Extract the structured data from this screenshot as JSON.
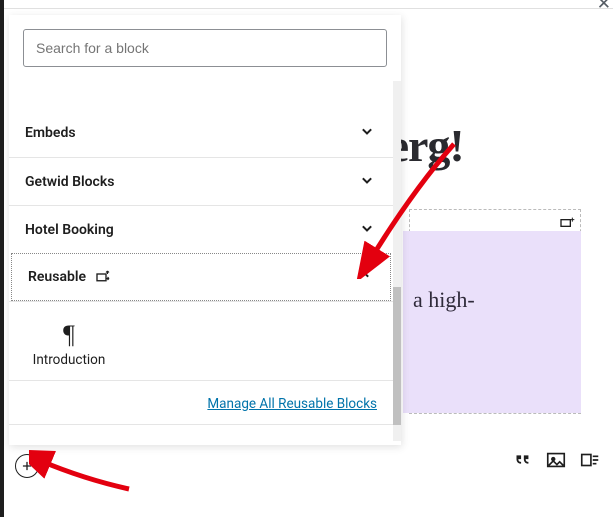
{
  "search": {
    "placeholder": "Search for a block"
  },
  "categories": [
    {
      "label": "Embeds",
      "open": false
    },
    {
      "label": "Getwid Blocks",
      "open": false
    },
    {
      "label": "Hotel Booking",
      "open": false
    },
    {
      "label": "Reusable",
      "open": true
    }
  ],
  "reusable_block": {
    "label": "Introduction"
  },
  "manage_link": "Manage All Reusable Blocks",
  "editor": {
    "title_fragment": "berg!",
    "inner_text_fragment": "a high-"
  }
}
